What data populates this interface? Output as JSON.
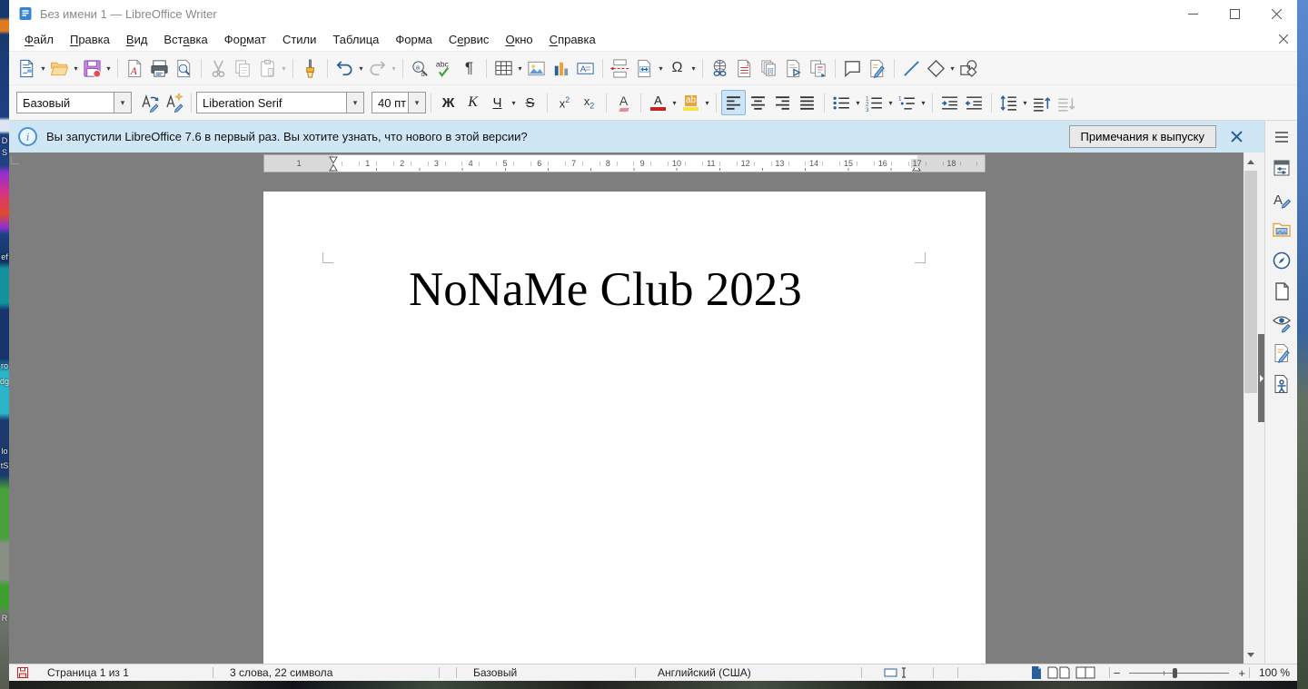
{
  "titlebar": {
    "title": "Без имени 1 — LibreOffice Writer"
  },
  "menubar": {
    "items": [
      {
        "pre": "",
        "key": "Ф",
        "post": "айл"
      },
      {
        "pre": "",
        "key": "П",
        "post": "равка"
      },
      {
        "pre": "",
        "key": "В",
        "post": "ид"
      },
      {
        "pre": "Вст",
        "key": "а",
        "post": "вка"
      },
      {
        "pre": "Фо",
        "key": "р",
        "post": "мат"
      },
      {
        "pre": "Стили",
        "key": "",
        "post": ""
      },
      {
        "pre": "Таблица",
        "key": "",
        "post": ""
      },
      {
        "pre": "Форма",
        "key": "",
        "post": ""
      },
      {
        "pre": "С",
        "key": "е",
        "post": "рвис"
      },
      {
        "pre": "",
        "key": "О",
        "post": "кно"
      },
      {
        "pre": "",
        "key": "С",
        "post": "правка"
      }
    ]
  },
  "standard_toolbar": {
    "icons": [
      "new-document",
      "open",
      "save",
      "export-pdf",
      "print",
      "print-preview",
      "cut",
      "copy",
      "paste",
      "clone-formatting",
      "undo",
      "redo",
      "find-replace",
      "spelling",
      "formatting-marks",
      "insert-table",
      "insert-image",
      "insert-chart",
      "insert-text-box",
      "insert-page-break",
      "insert-field",
      "insert-special-character",
      "insert-hyperlink",
      "insert-footnote",
      "insert-endnote",
      "insert-bookmark",
      "insert-cross-reference",
      "insert-comment",
      "track-changes",
      "insert-line",
      "basic-shapes",
      "show-draw-functions"
    ]
  },
  "formatting_toolbar": {
    "paragraph_style": "Базовый",
    "font_name": "Liberation Serif",
    "font_size": "40 пт",
    "glyphs": {
      "bold": "Ж",
      "italic": "К",
      "underline": "Ч",
      "strikethrough": "S",
      "sup_base": "x",
      "sup_exp": "2",
      "sub_base": "x",
      "sub_idx": "2",
      "clear": "A",
      "font_color": "A",
      "highlight": "ab"
    }
  },
  "infobar": {
    "text": "Вы запустили LibreOffice 7.6 в первый раз. Вы хотите узнать, что нового в этой версии?",
    "button_label": "Примечания к выпуску"
  },
  "ruler": {
    "unit_numbers": [
      {
        "label": "1",
        "cm": -1
      },
      {
        "label": "1",
        "cm": 1
      },
      {
        "label": "2",
        "cm": 2
      },
      {
        "label": "3",
        "cm": 3
      },
      {
        "label": "4",
        "cm": 4
      },
      {
        "label": "5",
        "cm": 5
      },
      {
        "label": "6",
        "cm": 6
      },
      {
        "label": "7",
        "cm": 7
      },
      {
        "label": "8",
        "cm": 8
      },
      {
        "label": "9",
        "cm": 9
      },
      {
        "label": "10",
        "cm": 10
      },
      {
        "label": "11",
        "cm": 11
      },
      {
        "label": "12",
        "cm": 12
      },
      {
        "label": "13",
        "cm": 13
      },
      {
        "label": "14",
        "cm": 14
      },
      {
        "label": "15",
        "cm": 15
      },
      {
        "label": "16",
        "cm": 16
      },
      {
        "label": "17",
        "cm": 17
      },
      {
        "label": "18",
        "cm": 18
      }
    ]
  },
  "document": {
    "text": "NoNaMe Club 2023"
  },
  "sidebar": {
    "icons": [
      "sidebar-settings",
      "properties",
      "styles",
      "gallery",
      "navigator",
      "page",
      "style-inspector",
      "track-changes",
      "accessibility-check"
    ]
  },
  "statusbar": {
    "page": "Страница 1 из 1",
    "word_count": "3 слова, 22 символа",
    "paragraph_style": "Базовый",
    "language": "Английский (США)",
    "zoom_percent": "100 %"
  },
  "toolbar_glyphs": {
    "pilcrow": "¶",
    "spelling": "abc",
    "omega": "Ω",
    "find_a": "a",
    "find_d": "d",
    "footnote": "1",
    "endnote": "[i]",
    "textbox": "A",
    "pdf": "A",
    "num1": "1",
    "num2": "2",
    "num3": "3",
    "outline1": "1"
  },
  "desktop_fragments": [
    "D",
    "S",
    "ef",
    "ro",
    "dg",
    "lo",
    "tS",
    "R"
  ],
  "colors": {
    "accent_blue": "#2a6099",
    "infobar_bg": "#cfe7f5",
    "workspace_gray": "#7e7e7e",
    "active_button_bg": "#cce4f7",
    "unsaved_red": "#c9211e"
  }
}
